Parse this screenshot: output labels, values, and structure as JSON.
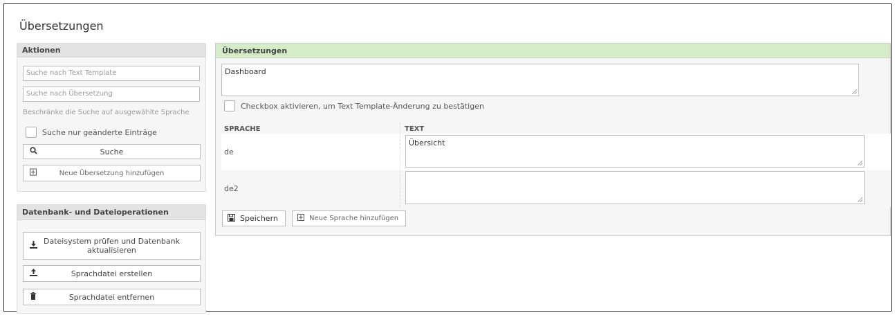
{
  "page": {
    "title": "Übersetzungen"
  },
  "actions": {
    "header": "Aktionen",
    "search_template_placeholder": "Suche nach Text Template",
    "search_translation_placeholder": "Suche nach Übersetzung",
    "restrict_hint": "Beschränke die Suche auf ausgewählte Sprache",
    "changed_only_label": "Suche nur geänderte Einträge",
    "search_button": "Suche",
    "add_translation_button": "Neue Übersetzung hinzufügen"
  },
  "db_ops": {
    "header": "Datenbank- und Dateioperationen",
    "check_fs_button_line1": "Dateisystem prüfen und Datenbank",
    "check_fs_button_line2": "aktualisieren",
    "create_lang_file_button": "Sprachdatei erstellen",
    "remove_lang_file_button": "Sprachdatei entfernen"
  },
  "translations": {
    "header": "Übersetzungen",
    "template_text": "Dashboard",
    "confirm_label": "Checkbox aktivieren, um Text Template-Änderung zu bestätigen",
    "columns": {
      "language": "SPRACHE",
      "text": "TEXT"
    },
    "rows": [
      {
        "language": "de",
        "text": "Übersicht"
      },
      {
        "language": "de2",
        "text": ""
      }
    ],
    "save_button": "Speichern",
    "add_language_button": "Neue Sprache hinzufügen"
  },
  "icons": {
    "search": "magnifier-icon",
    "add": "plus-square-icon",
    "download": "download-icon",
    "upload": "upload-icon",
    "trash": "trash-icon",
    "save": "floppy-icon"
  },
  "colors": {
    "panel_header_green": "#d5ecc8",
    "sidebar_header_gray": "#e3e3e3"
  }
}
